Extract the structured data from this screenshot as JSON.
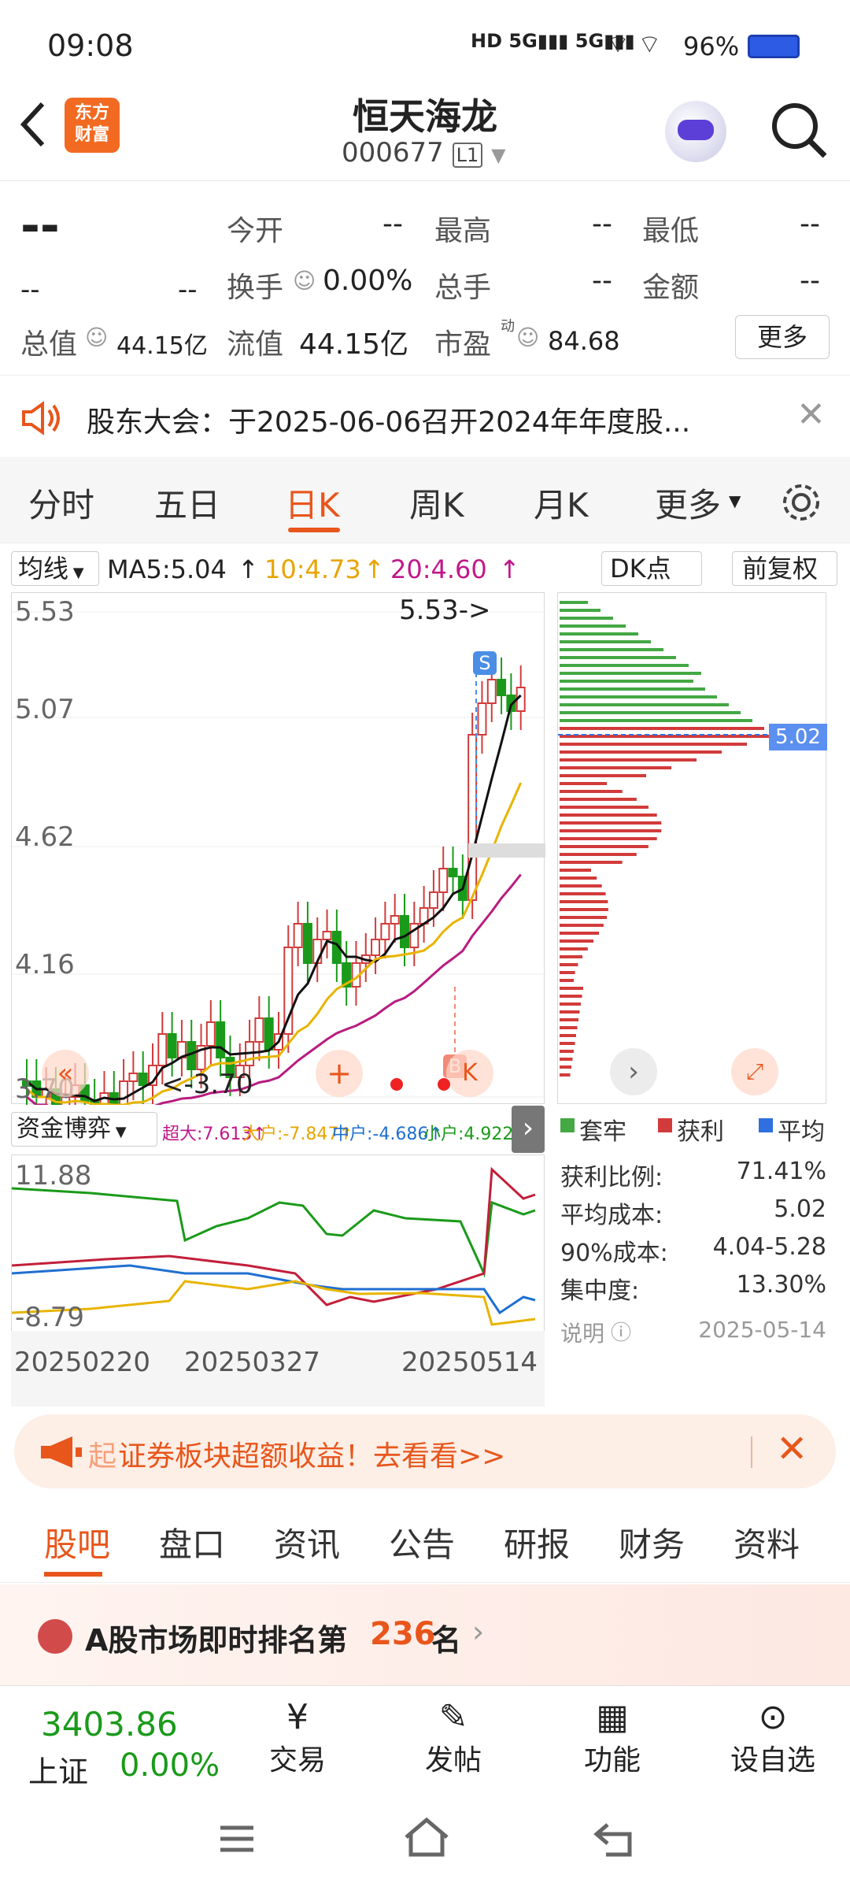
{
  "status": {
    "time": "09:08",
    "battery": "96%"
  },
  "header": {
    "title": "恒天海龙",
    "code": "000677",
    "level": "L1",
    "logo_line1": "东方",
    "logo_line2": "财富"
  },
  "quote": {
    "price": "--",
    "change": "--",
    "change_pct": "--",
    "open_label": "今开",
    "open": "--",
    "high_label": "最高",
    "high": "--",
    "low_label": "最低",
    "low": "--",
    "turnover_label": "换手",
    "turnover": "0.00%",
    "volume_label": "总手",
    "volume": "--",
    "amount_label": "金额",
    "amount": "--",
    "mcap_label": "总值",
    "mcap": "44.15亿",
    "float_label": "流值",
    "float": "44.15亿",
    "pe_label": "市盈",
    "pe_sup": "动",
    "pe": "84.68",
    "more": "更多"
  },
  "notice": {
    "text": "股东大会：于2025-06-06召开2024年年度股..."
  },
  "chart_tabs": [
    "分时",
    "五日",
    "日K",
    "周K",
    "月K",
    "更多"
  ],
  "ma": {
    "label": "均线",
    "ma5": "MA5:5.04",
    "ma10": "10:4.73",
    "ma20": "20:4.60",
    "dk": "DK点",
    "adj": "前复权"
  },
  "kline": {
    "y_labels": [
      "5.53",
      "5.07",
      "4.62",
      "4.16",
      "3.70"
    ],
    "max_label": "5.53->",
    "min_label": "<-3.70",
    "s_mark": "S",
    "b_mark": "B",
    "b_label": "K"
  },
  "sub": {
    "label": "资金博弈",
    "super": "超大:7.613↑",
    "large": "大户:-7.847↑",
    "mid": "中户:-4.686↑",
    "small": "小户:4.922↓",
    "y_top": "11.88",
    "y_bot": "-8.79",
    "dates": [
      "20250220",
      "20250327",
      "20250514"
    ]
  },
  "dist": {
    "price_tag": "5.02",
    "legend": [
      "套牢",
      "获利",
      "平均"
    ],
    "rows": [
      {
        "k": "获利比例:",
        "v": "71.41%"
      },
      {
        "k": "平均成本:",
        "v": "5.02"
      },
      {
        "k": "90%成本:",
        "v": "4.04-5.28"
      },
      {
        "k": "集中度:",
        "v": "13.30%"
      }
    ],
    "note": "说明",
    "date": "2025-05-14"
  },
  "banner": {
    "text": "证券板块超额收益！去看看>>",
    "lead": "起"
  },
  "bottom_tabs": [
    "股吧",
    "盘口",
    "资讯",
    "公告",
    "研报",
    "财务",
    "资料"
  ],
  "rank": {
    "prefix": "A股市场即时排名第",
    "num": "236",
    "suffix": "名"
  },
  "footer": {
    "index_val": "3403.86",
    "index_name": "上证",
    "index_pct": "0.00%",
    "items": [
      "交易",
      "发帖",
      "功能",
      "设自选"
    ]
  },
  "colors": {
    "accent": "#e8561b",
    "up": "#d23b3b",
    "down": "#1a9a1a"
  }
}
